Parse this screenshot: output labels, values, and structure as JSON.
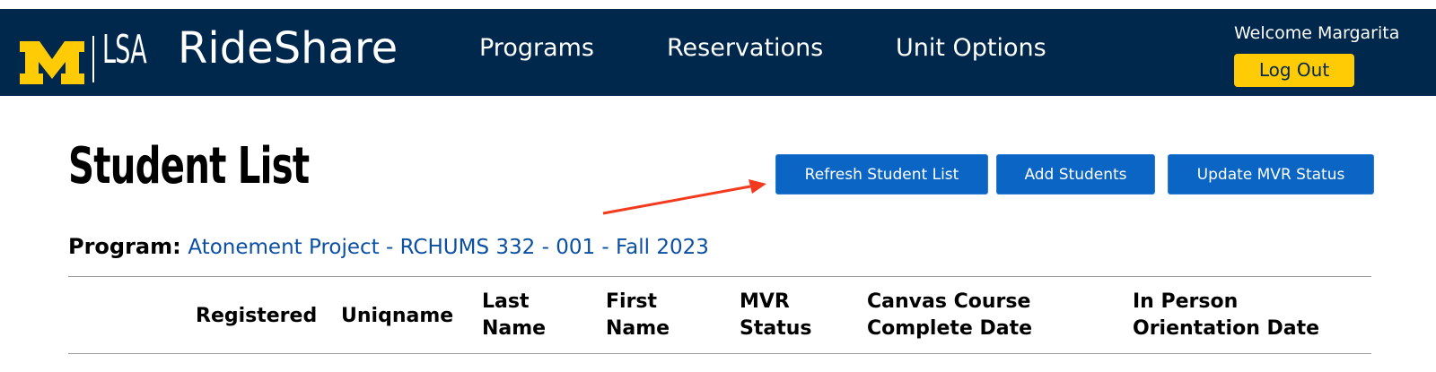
{
  "header": {
    "brand_lsa": "LSA",
    "app_title": "RideShare",
    "nav": [
      {
        "label": "Programs"
      },
      {
        "label": "Reservations"
      },
      {
        "label": "Unit Options"
      }
    ],
    "welcome_text": "Welcome Margarita",
    "logout_label": "Log Out",
    "colors": {
      "navy": "#00274c",
      "maize": "#ffcb05"
    }
  },
  "main": {
    "page_title": "Student List",
    "buttons": {
      "refresh": "Refresh Student List",
      "add": "Add Students",
      "update_mvr": "Update MVR Status"
    },
    "program_label": "Program:",
    "program_value": "Atonement Project - RCHUMS 332 - 001 - Fall 2023",
    "table": {
      "headers": [
        {
          "line1": "Registered",
          "line2": ""
        },
        {
          "line1": "Uniqname",
          "line2": ""
        },
        {
          "line1": "Last",
          "line2": "Name"
        },
        {
          "line1": "First",
          "line2": "Name"
        },
        {
          "line1": "MVR",
          "line2": "Status"
        },
        {
          "line1": "Canvas Course",
          "line2": "Complete Date"
        },
        {
          "line1": "In Person",
          "line2": "Orientation Date"
        }
      ]
    }
  }
}
